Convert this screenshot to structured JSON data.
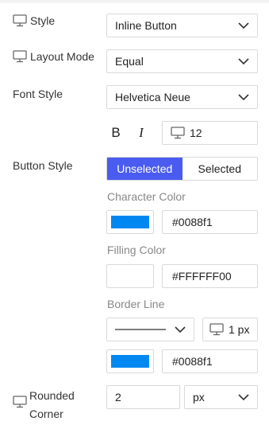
{
  "style": {
    "label": "Style",
    "value": "Inline Button"
  },
  "layout_mode": {
    "label": "Layout Mode",
    "value": "Equal"
  },
  "font_style": {
    "label": "Font Style",
    "value": "Helvetica Neue",
    "bold_label": "B",
    "italic_label": "I",
    "size_value": "12"
  },
  "button_style": {
    "label": "Button Style",
    "tabs": [
      {
        "label": "Unselected",
        "active": true
      },
      {
        "label": "Selected",
        "active": false
      }
    ],
    "character_color": {
      "label": "Character Color",
      "hex": "#0088f1",
      "swatch": "#0088f1"
    },
    "filling_color": {
      "label": "Filling Color",
      "hex": "#FFFFFF00"
    },
    "border_line": {
      "label": "Border Line",
      "width_value": "1 px",
      "hex": "#0088f1",
      "swatch": "#0088f1"
    }
  },
  "rounded_corner": {
    "label_line1": "Rounded",
    "label_line2": "Corner",
    "value": "2",
    "unit": "px"
  },
  "icons": {
    "device": "monitor-icon",
    "dropdown": "chevron-down-icon"
  },
  "colors": {
    "accent": "#4a5cf0"
  }
}
